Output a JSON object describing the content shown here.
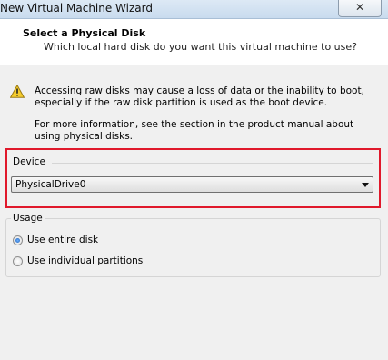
{
  "window": {
    "title": "New Virtual Machine Wizard",
    "close_glyph": "✕"
  },
  "header": {
    "title": "Select a Physical Disk",
    "subtitle": "Which local hard disk do you want this virtual machine to use?"
  },
  "warning": {
    "icon": "warning-icon",
    "text": "Accessing raw disks may cause a loss of data or the inability to boot, especially if the raw disk partition is used as the boot device.",
    "info": "For more information, see the section in the product manual about using physical disks."
  },
  "device": {
    "label": "Device",
    "selected": "PhysicalDrive0",
    "highlight_color": "#e0192b"
  },
  "usage": {
    "label": "Usage",
    "options": [
      {
        "label": "Use entire disk",
        "selected": true
      },
      {
        "label": "Use individual partitions",
        "selected": false
      }
    ]
  }
}
